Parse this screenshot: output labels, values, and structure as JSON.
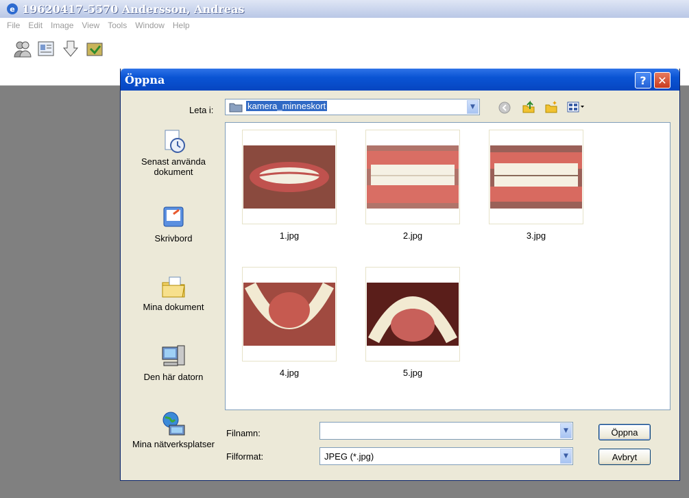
{
  "app": {
    "title": "19620417-5570 Andersson, Andreas",
    "menu": [
      "File",
      "Edit",
      "Image",
      "View",
      "Tools",
      "Window",
      "Help"
    ]
  },
  "dialog": {
    "title": "Öppna",
    "help_button": "?",
    "close_button": "✕",
    "look_in_label": "Leta i:",
    "look_in_value": "kamera_minneskort",
    "places": [
      {
        "label": "Senast använda dokument",
        "icon": "recent-documents-icon"
      },
      {
        "label": "Skrivbord",
        "icon": "desktop-icon"
      },
      {
        "label": "Mina dokument",
        "icon": "my-documents-icon"
      },
      {
        "label": "Den här datorn",
        "icon": "my-computer-icon"
      },
      {
        "label": "Mina nätverksplatser",
        "icon": "network-places-icon"
      }
    ],
    "files": [
      {
        "name": "1.jpg"
      },
      {
        "name": "2.jpg"
      },
      {
        "name": "3.jpg"
      },
      {
        "name": "4.jpg"
      },
      {
        "name": "5.jpg"
      }
    ],
    "filename_label": "Filnamn:",
    "filename_value": "",
    "filetype_label": "Filformat:",
    "filetype_value": "JPEG (*.jpg)",
    "open_button": "Öppna",
    "cancel_button": "Avbryt"
  },
  "colors": {
    "titlebar": "#0a54d4",
    "dialog_bg": "#ece9d8",
    "selection": "#316ac5"
  }
}
